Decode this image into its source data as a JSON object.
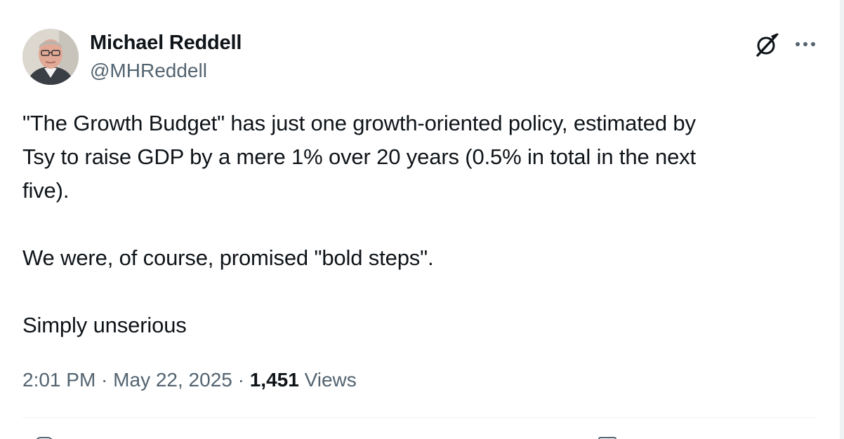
{
  "author": {
    "name": "Michael Reddell",
    "handle": "@MHReddell",
    "avatar_icon": "profile-photo"
  },
  "header_icons": {
    "grok": "grok-icon",
    "more": "more-options-icon"
  },
  "tweet": {
    "paragraphs": [
      "\"The Growth Budget\" has just one growth-oriented policy, estimated by\nTsy to raise GDP by a mere 1% over 20 years (0.5% in total in the next\nfive).",
      "We were, of course, promised \"bold steps\".",
      "Simply unserious"
    ]
  },
  "meta": {
    "time": "2:01 PM",
    "separator": " · ",
    "date": "May 22, 2025",
    "views_count": "1,451",
    "views_label": " Views"
  },
  "colors": {
    "text": "#0f1419",
    "secondary": "#536471",
    "divider": "#eff3f4"
  }
}
